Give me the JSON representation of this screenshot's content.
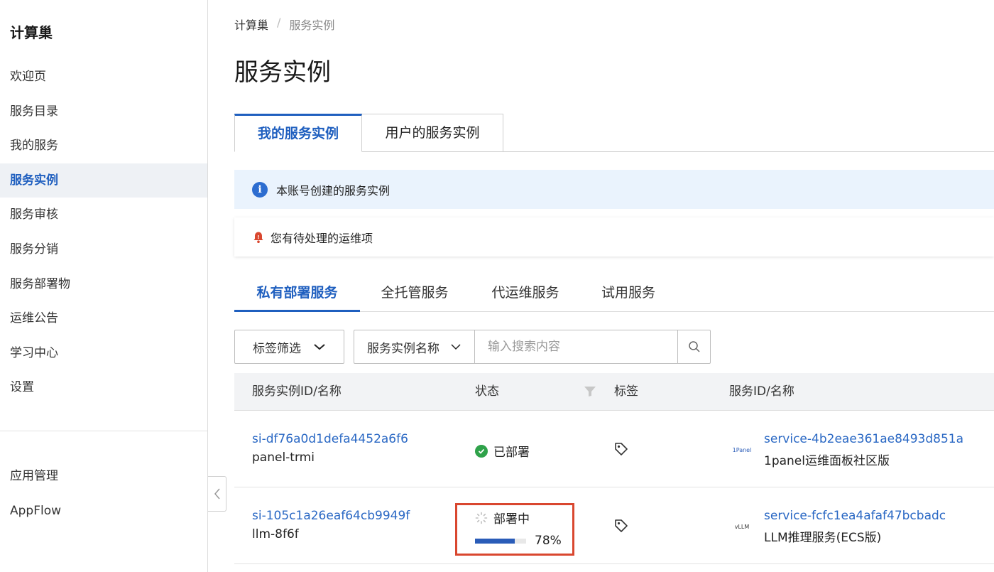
{
  "sidebar": {
    "title": "计算巢",
    "items": [
      {
        "label": "欢迎页",
        "active": false
      },
      {
        "label": "服务目录",
        "active": false
      },
      {
        "label": "我的服务",
        "active": false
      },
      {
        "label": "服务实例",
        "active": true
      },
      {
        "label": "服务审核",
        "active": false
      },
      {
        "label": "服务分销",
        "active": false
      },
      {
        "label": "服务部署物",
        "active": false
      },
      {
        "label": "运维公告",
        "active": false
      },
      {
        "label": "学习中心",
        "active": false
      },
      {
        "label": "设置",
        "active": false
      }
    ],
    "bottom_items": [
      {
        "label": "应用管理"
      },
      {
        "label": "AppFlow"
      }
    ]
  },
  "breadcrumb": {
    "root": "计算巢",
    "separator": "/",
    "current": "服务实例"
  },
  "page_title": "服务实例",
  "box_tabs": [
    {
      "label": "我的服务实例",
      "active": true
    },
    {
      "label": "用户的服务实例",
      "active": false
    }
  ],
  "info_bar": {
    "icon": "info-icon",
    "text": "本账号创建的服务实例"
  },
  "alert_bar": {
    "icon": "bell-alert-icon",
    "text": "您有待处理的运维项"
  },
  "sub_tabs": [
    {
      "label": "私有部署服务",
      "active": true
    },
    {
      "label": "全托管服务",
      "active": false
    },
    {
      "label": "代运维服务",
      "active": false
    },
    {
      "label": "试用服务",
      "active": false
    }
  ],
  "toolbar": {
    "tag_filter_label": "标签筛选",
    "search_field_label": "服务实例名称",
    "search_placeholder": "输入搜索内容"
  },
  "table": {
    "columns": [
      "服务实例ID/名称",
      "状态",
      "标签",
      "服务ID/名称"
    ],
    "rows": [
      {
        "instance_id": "si-df76a0d1defa4452a6f6",
        "instance_name": "panel-trmi",
        "status": "已部署",
        "status_type": "deployed",
        "service_logo": "1Panel",
        "service_id": "service-4b2eae361ae8493d851a",
        "service_name": "1panel运维面板社区版"
      },
      {
        "instance_id": "si-105c1a26eaf64cb9949f",
        "instance_name": "llm-8f6f",
        "status": "部署中",
        "status_type": "deploying",
        "progress": 78,
        "progress_label": "78%",
        "service_logo": "vLLM",
        "service_id": "service-fcfc1ea4afaf47bcbadc",
        "service_name": "LLM推理服务(ECS版)"
      }
    ]
  },
  "colors": {
    "accent": "#1f5fbf",
    "link": "#2a68c4",
    "success": "#2fa24a",
    "highlight": "#d9472f",
    "info_bg": "#eaf3fd"
  }
}
